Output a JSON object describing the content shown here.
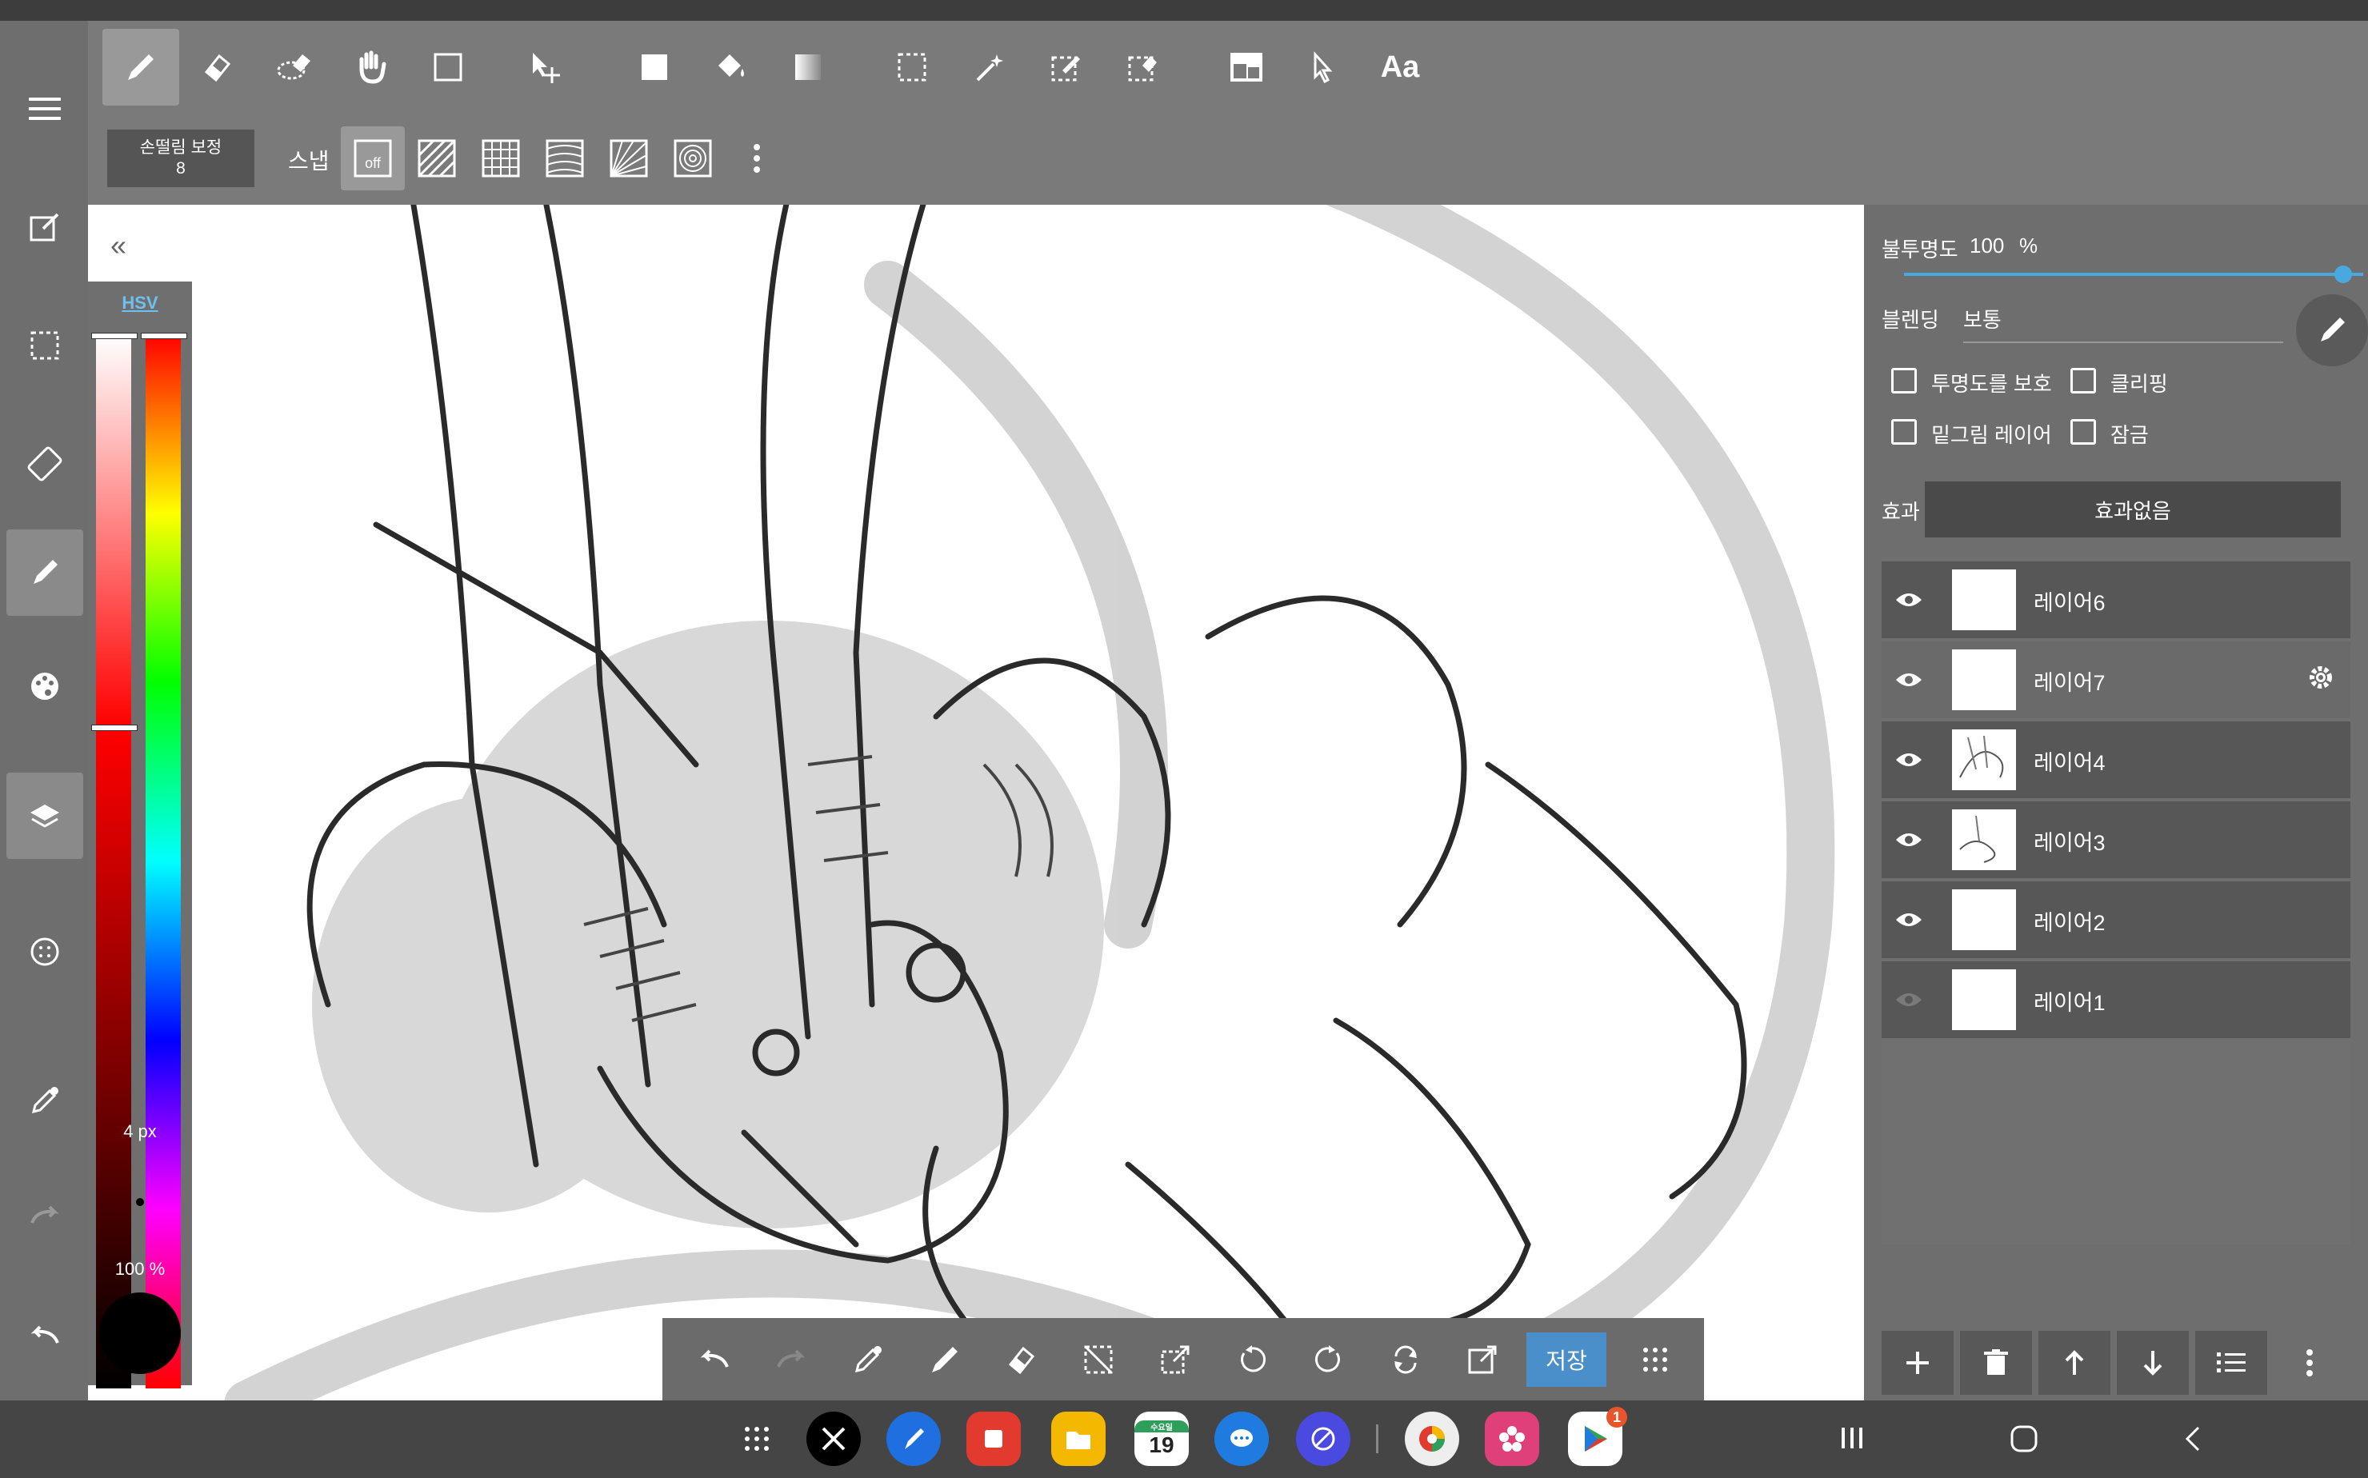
{
  "toolbar": {
    "text_tool_label": "Aa"
  },
  "options": {
    "stabilizer_label": "손떨림 보정",
    "stabilizer_value": "8",
    "snap_label": "스냅",
    "snap_off_label": "off"
  },
  "color_panel": {
    "mode_label": "HSV",
    "brush_size": "4 px",
    "opacity": "100 %",
    "current_color": "#000000"
  },
  "layer_props": {
    "opacity_label": "불투명도",
    "opacity_value": "100",
    "opacity_unit": "%",
    "opacity_level": 1.0,
    "blend_label": "블렌딩",
    "blend_value": "보통",
    "protect_alpha": "투명도를 보호",
    "clipping": "클리핑",
    "draft_layer": "밑그림 레이어",
    "lock": "잠금",
    "effect_label": "효과",
    "effect_value": "효과없음"
  },
  "layers": [
    {
      "name": "레이어6",
      "visible": true
    },
    {
      "name": "레이어7",
      "visible": true,
      "selected": true
    },
    {
      "name": "레이어4",
      "visible": true
    },
    {
      "name": "레이어3",
      "visible": true
    },
    {
      "name": "레이어2",
      "visible": true
    },
    {
      "name": "레이어1",
      "visible": false
    }
  ],
  "bottom_tools": {
    "save_label": "저장"
  },
  "taskbar": {
    "calendar_day": "19",
    "calendar_weekday": "수요일",
    "play_badge": "1"
  },
  "colors": {
    "accent": "#4a8fc9",
    "hsv_label": "#6fc0f0",
    "toolbar_bg": "#7a7a7a",
    "panel_bg": "#6e6e6e"
  }
}
